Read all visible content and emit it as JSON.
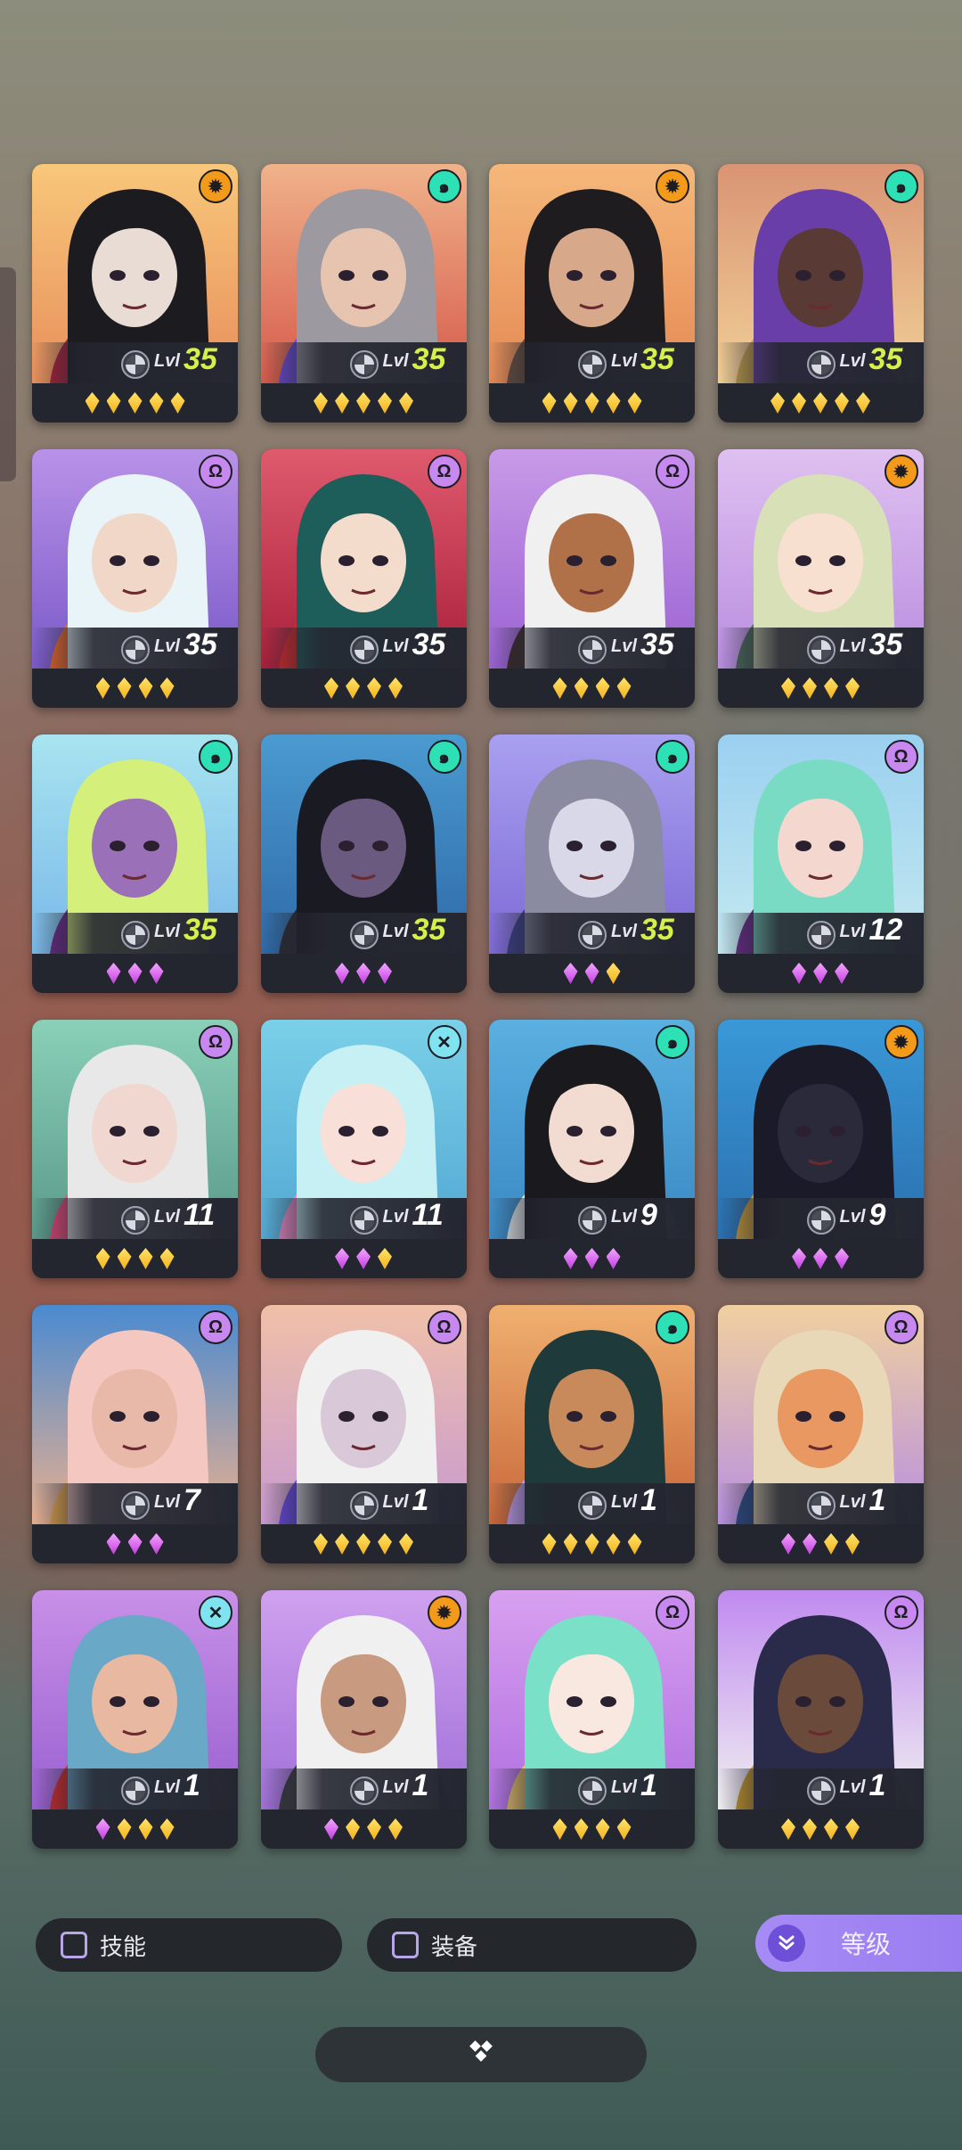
{
  "level_label": "Lvl",
  "heroes": [
    {
      "element": "sun",
      "level": "35",
      "max": true,
      "stars": [
        "gold",
        "gold",
        "gold",
        "gold",
        "gold"
      ],
      "bg": [
        "#f8c77a",
        "#e88f5c"
      ],
      "hair": "#1c1b1f",
      "skin": "#e9dcd4",
      "accent": "#b0203a"
    },
    {
      "element": "swirl",
      "level": "35",
      "max": true,
      "stars": [
        "gold",
        "gold",
        "gold",
        "gold",
        "gold"
      ],
      "bg": [
        "#f0b28a",
        "#d65b4b"
      ],
      "hair": "#9c9aa0",
      "skin": "#e6c4b0",
      "accent": "#6b4ad8"
    },
    {
      "element": "sun",
      "level": "35",
      "max": true,
      "stars": [
        "gold",
        "gold",
        "gold",
        "gold",
        "gold"
      ],
      "bg": [
        "#f5b87a",
        "#e58a55"
      ],
      "hair": "#1e1c1e",
      "skin": "#d7a98a",
      "accent": "#6a5040"
    },
    {
      "element": "swirl",
      "level": "35",
      "max": true,
      "stars": [
        "gold",
        "gold",
        "gold",
        "gold",
        "gold"
      ],
      "bg": [
        "#d99474",
        "#f0cf96"
      ],
      "hair": "#6a3ea8",
      "skin": "#5a3a34",
      "accent": "#c7a24a"
    },
    {
      "element": "omega",
      "level": "35",
      "max": false,
      "stars": [
        "gold",
        "gold",
        "gold",
        "gold"
      ],
      "bg": [
        "#b992e8",
        "#7a5ac8"
      ],
      "hair": "#e8f4f8",
      "skin": "#f0d7c8",
      "accent": "#f06a2a"
    },
    {
      "element": "omega",
      "level": "35",
      "max": false,
      "stars": [
        "gold",
        "gold",
        "gold",
        "gold"
      ],
      "bg": [
        "#e05a6e",
        "#a8203a"
      ],
      "hair": "#1e5e5a",
      "skin": "#f4dccd",
      "accent": "#d82828"
    },
    {
      "element": "omega",
      "level": "35",
      "max": false,
      "stars": [
        "gold",
        "gold",
        "gold",
        "gold"
      ],
      "bg": [
        "#c89ae8",
        "#9a62d2"
      ],
      "hair": "#f0f0f0",
      "skin": "#b07048",
      "accent": "#3a2a2a"
    },
    {
      "element": "sun",
      "level": "35",
      "max": false,
      "stars": [
        "gold",
        "gold",
        "gold",
        "gold"
      ],
      "bg": [
        "#dfc0f0",
        "#b98ee0"
      ],
      "hair": "#d8e0b8",
      "skin": "#f8e0d0",
      "accent": "#4a6a5a"
    },
    {
      "element": "swirl",
      "level": "35",
      "max": true,
      "stars": [
        "purple",
        "purple",
        "purple"
      ],
      "bg": [
        "#a8e4f0",
        "#7ab8e8"
      ],
      "hair": "#d4f07a",
      "skin": "#9a70b8",
      "accent": "#6a2a8a"
    },
    {
      "element": "swirl",
      "level": "35",
      "max": true,
      "stars": [
        "purple",
        "purple",
        "purple"
      ],
      "bg": [
        "#4a9ad0",
        "#2f6aa8"
      ],
      "hair": "#1a1a22",
      "skin": "#6a5a80",
      "accent": "#2a2a34"
    },
    {
      "element": "swirl",
      "level": "35",
      "max": true,
      "stars": [
        "purple",
        "purple",
        "gold"
      ],
      "bg": [
        "#a9a0f0",
        "#7e6ad6"
      ],
      "hair": "#8a8aa0",
      "skin": "#d8d8e8",
      "accent": "#3a3f88"
    },
    {
      "element": "omega",
      "level": "12",
      "max": false,
      "stars": [
        "purple",
        "purple",
        "purple"
      ],
      "bg": [
        "#9ad0f0",
        "#c4e8f0"
      ],
      "hair": "#7adbc4",
      "skin": "#f4d8d0",
      "accent": "#6a2a8a"
    },
    {
      "element": "omega",
      "level": "11",
      "max": false,
      "stars": [
        "gold",
        "gold",
        "gold",
        "gold"
      ],
      "bg": [
        "#8ad0b8",
        "#5a9a8a"
      ],
      "hair": "#e8e8e8",
      "skin": "#f0d8d0",
      "accent": "#e84a7a"
    },
    {
      "element": "cross",
      "level": "11",
      "max": false,
      "stars": [
        "purple",
        "purple",
        "gold"
      ],
      "bg": [
        "#7ad0e8",
        "#54a8d4"
      ],
      "hair": "#c6f0f4",
      "skin": "#f8e0d8",
      "accent": "#e88ac4"
    },
    {
      "element": "swirl",
      "level": "9",
      "max": false,
      "stars": [
        "purple",
        "purple",
        "purple"
      ],
      "bg": [
        "#5ab0e0",
        "#3a88c4"
      ],
      "hair": "#1a1a1e",
      "skin": "#f2dcd2",
      "accent": "#e4e8ea"
    },
    {
      "element": "sun",
      "level": "9",
      "max": false,
      "stars": [
        "purple",
        "purple",
        "purple"
      ],
      "bg": [
        "#3a98d6",
        "#2a70b0"
      ],
      "hair": "#1a1a28",
      "skin": "#2a2a3a",
      "accent": "#c79a3a"
    },
    {
      "element": "omega",
      "level": "7",
      "max": false,
      "stars": [
        "purple",
        "purple",
        "purple"
      ],
      "bg": [
        "#4a8ad0",
        "#e8b090"
      ],
      "hair": "#f4c8c0",
      "skin": "#e8b8a8",
      "accent": "#e8a84a"
    },
    {
      "element": "omega",
      "level": "1",
      "max": false,
      "stars": [
        "gold",
        "gold",
        "gold",
        "gold",
        "gold"
      ],
      "bg": [
        "#f0c0a8",
        "#c89ad0"
      ],
      "hair": "#f0f0f0",
      "skin": "#d8c8d8",
      "accent": "#6a4ae8"
    },
    {
      "element": "swirl",
      "level": "1",
      "max": false,
      "stars": [
        "gold",
        "gold",
        "gold",
        "gold",
        "gold"
      ],
      "bg": [
        "#f0b070",
        "#c8683a"
      ],
      "hair": "#1e3a3a",
      "skin": "#c88a5a",
      "accent": "#c4a0f0"
    },
    {
      "element": "omega",
      "level": "1",
      "max": false,
      "stars": [
        "purple",
        "purple",
        "gold",
        "gold"
      ],
      "bg": [
        "#f0d0a0",
        "#b890e0"
      ],
      "hair": "#e8d8b8",
      "skin": "#e89860",
      "accent": "#2a4a8a"
    },
    {
      "element": "cross",
      "level": "1",
      "max": false,
      "stars": [
        "purple",
        "gold",
        "gold",
        "gold"
      ],
      "bg": [
        "#c890e8",
        "#9a60d0"
      ],
      "hair": "#6aa8c8",
      "skin": "#e8b8a0",
      "accent": "#d82a2a"
    },
    {
      "element": "sun",
      "level": "1",
      "max": false,
      "stars": [
        "purple",
        "gold",
        "gold",
        "gold"
      ],
      "bg": [
        "#d0a0f0",
        "#a070d8"
      ],
      "hair": "#f0f0f0",
      "skin": "#c89a80",
      "accent": "#3a3a40"
    },
    {
      "element": "omega",
      "level": "1",
      "max": false,
      "stars": [
        "gold",
        "gold",
        "gold",
        "gold"
      ],
      "bg": [
        "#d8a0f0",
        "#b070e0"
      ],
      "hair": "#7ae0c8",
      "skin": "#f8e8e0",
      "accent": "#e8c06a"
    },
    {
      "element": "omega",
      "level": "1",
      "max": false,
      "stars": [
        "gold",
        "gold",
        "gold",
        "gold"
      ],
      "bg": [
        "#c08af0",
        "#f0f0f0"
      ],
      "hair": "#2a2a4a",
      "skin": "#6a4a3a",
      "accent": "#c89a2a"
    }
  ],
  "filters": {
    "skill_label": "技能",
    "equipment_label": "装备"
  },
  "sort_button": {
    "label": "等级",
    "icon": "double-chevron-down-icon"
  },
  "bottom_button": {
    "icon": "diamond-cluster-icon"
  }
}
